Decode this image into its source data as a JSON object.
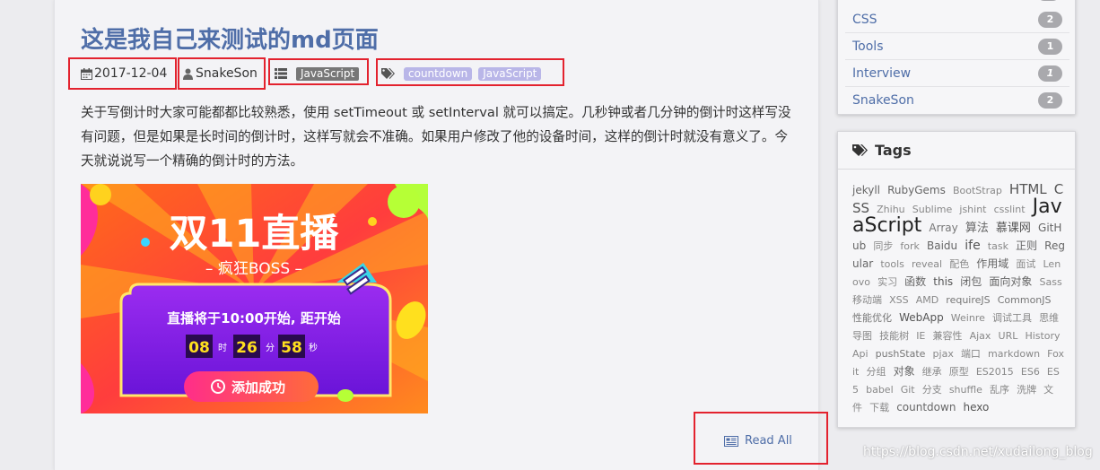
{
  "post": {
    "title": "这是我自己来测试的md页面",
    "date": "2017-12-04",
    "author": "SnakeSon",
    "category": "JavaScript",
    "tags": [
      "countdown",
      "JavaScript"
    ],
    "excerpt": "关于写倒计时大家可能都都比较熟悉，使用 setTimeout 或 setInterval 就可以搞定。几秒钟或者几分钟的倒计时这样写没有问题，但是如果是长时间的倒计时，这样写就会不准确。如果用户修改了他的设备时间，这样的倒计时就没有意义了。今天就说说写一个精确的倒计时的方法。",
    "read_all": "Read All"
  },
  "banner": {
    "headline": "双11直播",
    "subtitle": "– 疯狂BOSS –",
    "countdown_text": "直播将于10:00开始, 距开始",
    "hours": "08",
    "hours_unit": "时",
    "minutes": "26",
    "minutes_unit": "分",
    "seconds": "58",
    "seconds_unit": "秒",
    "button": "添加成功"
  },
  "categories": [
    {
      "name": "CSS",
      "count": "2"
    },
    {
      "name": "Tools",
      "count": "1"
    },
    {
      "name": "Interview",
      "count": "1"
    },
    {
      "name": "SnakeSon",
      "count": "2"
    }
  ],
  "tags_panel": {
    "title": "Tags",
    "cloud": [
      {
        "t": "jekyll",
        "s": 12,
        "c": "#666"
      },
      {
        "t": "RubyGems",
        "s": 12,
        "c": "#666"
      },
      {
        "t": "BootStrap",
        "s": 11,
        "c": "#888"
      },
      {
        "t": "HTML",
        "s": 15,
        "c": "#555"
      },
      {
        "t": "CSS",
        "s": 15,
        "c": "#555"
      },
      {
        "t": "Zhihu",
        "s": 11,
        "c": "#888"
      },
      {
        "t": "Sublime",
        "s": 11,
        "c": "#888"
      },
      {
        "t": "jshint",
        "s": 11,
        "c": "#888"
      },
      {
        "t": "csslint",
        "s": 11,
        "c": "#888"
      },
      {
        "t": "JavaScript",
        "s": 22,
        "c": "#222"
      },
      {
        "t": "Array",
        "s": 12,
        "c": "#777"
      },
      {
        "t": "算法",
        "s": 13,
        "c": "#666"
      },
      {
        "t": "慕课网",
        "s": 13,
        "c": "#555"
      },
      {
        "t": "GitHub",
        "s": 12,
        "c": "#666"
      },
      {
        "t": "同步",
        "s": 11,
        "c": "#888"
      },
      {
        "t": "fork",
        "s": 11,
        "c": "#888"
      },
      {
        "t": "Baidu",
        "s": 12,
        "c": "#666"
      },
      {
        "t": "ife",
        "s": 14,
        "c": "#555"
      },
      {
        "t": "task",
        "s": 11,
        "c": "#888"
      },
      {
        "t": "正则",
        "s": 12,
        "c": "#666"
      },
      {
        "t": "Regular",
        "s": 12,
        "c": "#666"
      },
      {
        "t": "tools",
        "s": 11,
        "c": "#888"
      },
      {
        "t": "reveal",
        "s": 11,
        "c": "#888"
      },
      {
        "t": "配色",
        "s": 11,
        "c": "#888"
      },
      {
        "t": "作用域",
        "s": 12,
        "c": "#666"
      },
      {
        "t": "面试",
        "s": 11,
        "c": "#888"
      },
      {
        "t": "Lenovo",
        "s": 11,
        "c": "#888"
      },
      {
        "t": "实习",
        "s": 11,
        "c": "#888"
      },
      {
        "t": "函数",
        "s": 12,
        "c": "#666"
      },
      {
        "t": "this",
        "s": 12,
        "c": "#555"
      },
      {
        "t": "闭包",
        "s": 12,
        "c": "#666"
      },
      {
        "t": "面向对象",
        "s": 12,
        "c": "#666"
      },
      {
        "t": "Sass",
        "s": 11,
        "c": "#888"
      },
      {
        "t": "移动端",
        "s": 11,
        "c": "#888"
      },
      {
        "t": "XSS",
        "s": 11,
        "c": "#888"
      },
      {
        "t": "AMD",
        "s": 11,
        "c": "#888"
      },
      {
        "t": "requireJS",
        "s": 11,
        "c": "#777"
      },
      {
        "t": "CommonJS",
        "s": 11,
        "c": "#777"
      },
      {
        "t": "性能优化",
        "s": 11,
        "c": "#777"
      },
      {
        "t": "WebApp",
        "s": 12,
        "c": "#555"
      },
      {
        "t": "Weinre",
        "s": 11,
        "c": "#888"
      },
      {
        "t": "调试工具",
        "s": 11,
        "c": "#888"
      },
      {
        "t": "思维导图",
        "s": 11,
        "c": "#888"
      },
      {
        "t": "技能树",
        "s": 11,
        "c": "#888"
      },
      {
        "t": "IE",
        "s": 11,
        "c": "#888"
      },
      {
        "t": "兼容性",
        "s": 11,
        "c": "#888"
      },
      {
        "t": "Ajax",
        "s": 11,
        "c": "#888"
      },
      {
        "t": "URL",
        "s": 11,
        "c": "#888"
      },
      {
        "t": "HistoryApi",
        "s": 11,
        "c": "#888"
      },
      {
        "t": "pushState",
        "s": 11,
        "c": "#777"
      },
      {
        "t": "pjax",
        "s": 11,
        "c": "#888"
      },
      {
        "t": "端口",
        "s": 11,
        "c": "#888"
      },
      {
        "t": "markdown",
        "s": 11,
        "c": "#888"
      },
      {
        "t": "Foxit",
        "s": 11,
        "c": "#888"
      },
      {
        "t": "分组",
        "s": 11,
        "c": "#888"
      },
      {
        "t": "对象",
        "s": 12,
        "c": "#666"
      },
      {
        "t": "继承",
        "s": 11,
        "c": "#888"
      },
      {
        "t": "原型",
        "s": 11,
        "c": "#888"
      },
      {
        "t": "ES2015",
        "s": 11,
        "c": "#888"
      },
      {
        "t": "ES6",
        "s": 11,
        "c": "#888"
      },
      {
        "t": "ES5",
        "s": 11,
        "c": "#888"
      },
      {
        "t": "babel",
        "s": 11,
        "c": "#888"
      },
      {
        "t": "Git",
        "s": 11,
        "c": "#888"
      },
      {
        "t": "分支",
        "s": 11,
        "c": "#888"
      },
      {
        "t": "shuffle",
        "s": 11,
        "c": "#888"
      },
      {
        "t": "乱序",
        "s": 11,
        "c": "#888"
      },
      {
        "t": "洗牌",
        "s": 11,
        "c": "#888"
      },
      {
        "t": "文件",
        "s": 11,
        "c": "#888"
      },
      {
        "t": "下载",
        "s": 11,
        "c": "#888"
      },
      {
        "t": "countdown",
        "s": 12,
        "c": "#666"
      },
      {
        "t": "hexo",
        "s": 12,
        "c": "#555"
      }
    ]
  },
  "watermark": "https://blog.csdn.net/xudailong_blog",
  "colors": {
    "link": "#4f6ea8",
    "highlight_box": "#e3222e",
    "category_label": "#777777",
    "tag_pill": "#b9b6e8",
    "badge": "#a9a9ad"
  }
}
